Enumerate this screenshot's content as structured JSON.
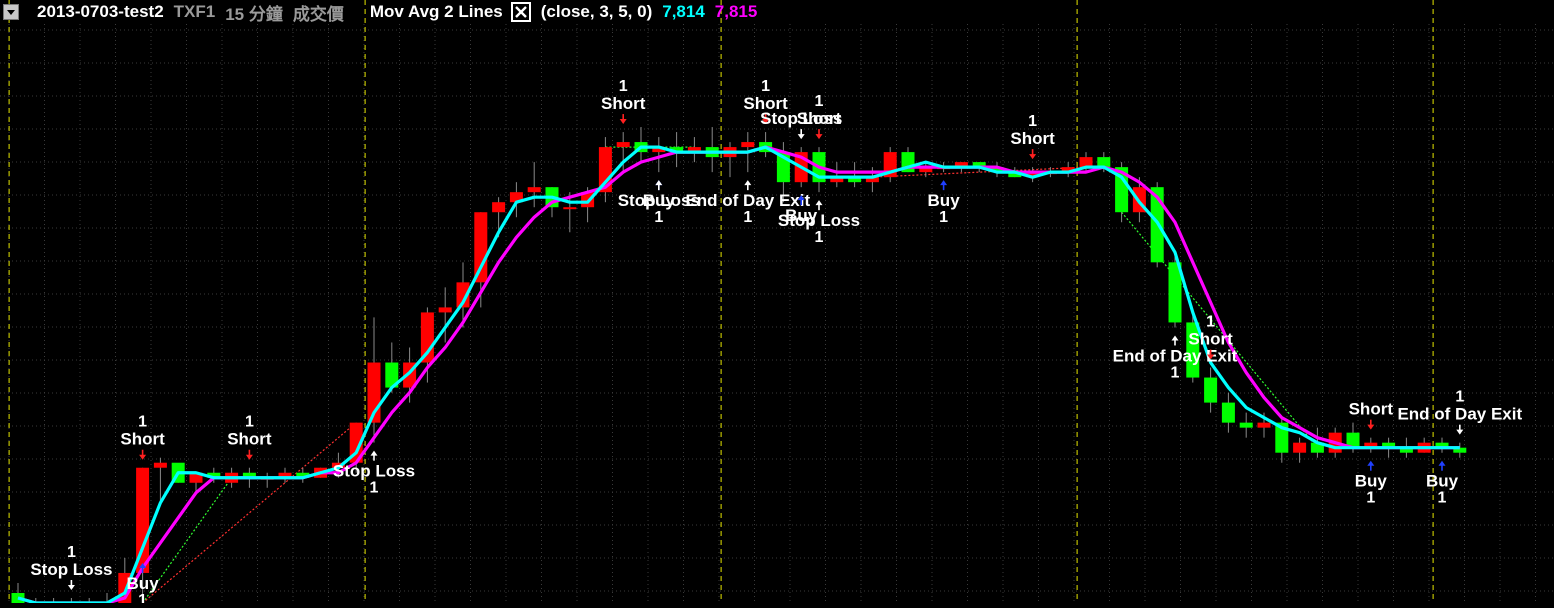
{
  "header": {
    "menu_icon": "dropdown-arrow-icon",
    "strategy": "2013-0703-test2",
    "symbol": "TXF1",
    "interval": "15 分鐘",
    "field": "成交價",
    "indicator": "Mov Avg 2 Lines",
    "close_icon": "close-x-icon",
    "params": "(close,  3,  5,  0)",
    "ma1_value": "7,814",
    "ma2_value": "7,815"
  },
  "colors": {
    "background": "#000000",
    "grid": "#3a3a3a",
    "session_divider": "#e6e600",
    "up_candle": "#ff0000",
    "down_candle": "#00ff00",
    "ma_fast": "#00ffff",
    "ma_slow": "#ff00ff",
    "label": "#ffffff",
    "short_arrow": "#ff2020",
    "buy_arrow": "#2040ff",
    "exit_arrow": "#ffffff",
    "trade_loss": "#ff3030",
    "trade_win": "#30ff30"
  },
  "chart_data": {
    "type": "candlestick",
    "title": "2013-0703-test2 TXF1 15 分鐘 成交價",
    "ylim": [
      0,
      100
    ],
    "grid": true,
    "session_dividers": [
      0,
      20,
      40,
      60,
      80
    ],
    "candles": [
      {
        "o": 2,
        "h": 4,
        "l": 0,
        "c": 0
      },
      {
        "o": 0,
        "h": 1,
        "l": 0,
        "c": 0
      },
      {
        "o": 0,
        "h": 1,
        "l": 0,
        "c": 0
      },
      {
        "o": 0,
        "h": 1,
        "l": 0,
        "c": 0
      },
      {
        "o": 0,
        "h": 1,
        "l": 0,
        "c": 0
      },
      {
        "o": 0,
        "h": 2,
        "l": 0,
        "c": 0
      },
      {
        "o": 0,
        "h": 9,
        "l": 0,
        "c": 6
      },
      {
        "o": 6,
        "h": 27,
        "l": 0,
        "c": 27
      },
      {
        "o": 27,
        "h": 29,
        "l": 20,
        "c": 28
      },
      {
        "o": 28,
        "h": 27,
        "l": 24,
        "c": 24
      },
      {
        "o": 24,
        "h": 26,
        "l": 22,
        "c": 26
      },
      {
        "o": 26,
        "h": 27,
        "l": 24,
        "c": 25
      },
      {
        "o": 24,
        "h": 27,
        "l": 23,
        "c": 26
      },
      {
        "o": 26,
        "h": 27,
        "l": 23,
        "c": 25
      },
      {
        "o": 25,
        "h": 26,
        "l": 23,
        "c": 25
      },
      {
        "o": 25,
        "h": 27,
        "l": 24,
        "c": 26
      },
      {
        "o": 26,
        "h": 27,
        "l": 24,
        "c": 25
      },
      {
        "o": 25,
        "h": 27,
        "l": 25,
        "c": 27
      },
      {
        "o": 27,
        "h": 30,
        "l": 25,
        "c": 28
      },
      {
        "o": 28,
        "h": 36,
        "l": 26,
        "c": 36
      },
      {
        "o": 36,
        "h": 57,
        "l": 32,
        "c": 48
      },
      {
        "o": 48,
        "h": 52,
        "l": 42,
        "c": 43
      },
      {
        "o": 43,
        "h": 51,
        "l": 40,
        "c": 48
      },
      {
        "o": 48,
        "h": 59,
        "l": 44,
        "c": 58
      },
      {
        "o": 58,
        "h": 63,
        "l": 52,
        "c": 59
      },
      {
        "o": 59,
        "h": 68,
        "l": 55,
        "c": 64
      },
      {
        "o": 64,
        "h": 78,
        "l": 59,
        "c": 78
      },
      {
        "o": 78,
        "h": 81,
        "l": 73,
        "c": 80
      },
      {
        "o": 80,
        "h": 84,
        "l": 77,
        "c": 82
      },
      {
        "o": 82,
        "h": 88,
        "l": 79,
        "c": 83
      },
      {
        "o": 83,
        "h": 83,
        "l": 77,
        "c": 79
      },
      {
        "o": 79,
        "h": 82,
        "l": 74,
        "c": 79
      },
      {
        "o": 79,
        "h": 83,
        "l": 76,
        "c": 82
      },
      {
        "o": 82,
        "h": 93,
        "l": 80,
        "c": 91
      },
      {
        "o": 91,
        "h": 94,
        "l": 86,
        "c": 92
      },
      {
        "o": 92,
        "h": 95,
        "l": 88,
        "c": 90
      },
      {
        "o": 90,
        "h": 93,
        "l": 86,
        "c": 91
      },
      {
        "o": 91,
        "h": 94,
        "l": 87,
        "c": 90
      },
      {
        "o": 90,
        "h": 93,
        "l": 88,
        "c": 91
      },
      {
        "o": 91,
        "h": 95,
        "l": 86,
        "c": 89
      },
      {
        "o": 89,
        "h": 92,
        "l": 85,
        "c": 91
      },
      {
        "o": 91,
        "h": 94,
        "l": 86,
        "c": 92
      },
      {
        "o": 92,
        "h": 94,
        "l": 89,
        "c": 90
      },
      {
        "o": 90,
        "h": 92,
        "l": 80,
        "c": 84
      },
      {
        "o": 84,
        "h": 91,
        "l": 83,
        "c": 90
      },
      {
        "o": 90,
        "h": 91,
        "l": 82,
        "c": 84
      },
      {
        "o": 84,
        "h": 88,
        "l": 83,
        "c": 85
      },
      {
        "o": 85,
        "h": 88,
        "l": 83,
        "c": 84
      },
      {
        "o": 84,
        "h": 87,
        "l": 82,
        "c": 85
      },
      {
        "o": 85,
        "h": 91,
        "l": 84,
        "c": 90
      },
      {
        "o": 90,
        "h": 91,
        "l": 86,
        "c": 86
      },
      {
        "o": 86,
        "h": 88,
        "l": 85,
        "c": 87
      },
      {
        "o": 87,
        "h": 88,
        "l": 86,
        "c": 87
      },
      {
        "o": 87,
        "h": 88,
        "l": 86,
        "c": 88
      },
      {
        "o": 88,
        "h": 88,
        "l": 86,
        "c": 87
      },
      {
        "o": 87,
        "h": 88,
        "l": 85,
        "c": 86
      },
      {
        "o": 86,
        "h": 87,
        "l": 85,
        "c": 85
      },
      {
        "o": 85,
        "h": 87,
        "l": 84,
        "c": 86
      },
      {
        "o": 86,
        "h": 87,
        "l": 85,
        "c": 86
      },
      {
        "o": 86,
        "h": 88,
        "l": 85,
        "c": 87
      },
      {
        "o": 87,
        "h": 90,
        "l": 86,
        "c": 89
      },
      {
        "o": 89,
        "h": 90,
        "l": 86,
        "c": 87
      },
      {
        "o": 87,
        "h": 88,
        "l": 76,
        "c": 78
      },
      {
        "o": 78,
        "h": 85,
        "l": 76,
        "c": 83
      },
      {
        "o": 83,
        "h": 84,
        "l": 67,
        "c": 68
      },
      {
        "o": 68,
        "h": 70,
        "l": 55,
        "c": 56
      },
      {
        "o": 56,
        "h": 58,
        "l": 44,
        "c": 45
      },
      {
        "o": 45,
        "h": 47,
        "l": 38,
        "c": 40
      },
      {
        "o": 40,
        "h": 42,
        "l": 34,
        "c": 36
      },
      {
        "o": 36,
        "h": 38,
        "l": 33,
        "c": 35
      },
      {
        "o": 35,
        "h": 38,
        "l": 33,
        "c": 36
      },
      {
        "o": 36,
        "h": 37,
        "l": 28,
        "c": 30
      },
      {
        "o": 30,
        "h": 33,
        "l": 28,
        "c": 32
      },
      {
        "o": 32,
        "h": 35,
        "l": 29,
        "c": 30
      },
      {
        "o": 30,
        "h": 35,
        "l": 29,
        "c": 34
      },
      {
        "o": 34,
        "h": 36,
        "l": 30,
        "c": 31
      },
      {
        "o": 31,
        "h": 33,
        "l": 30,
        "c": 32
      },
      {
        "o": 32,
        "h": 33,
        "l": 29,
        "c": 31
      },
      {
        "o": 31,
        "h": 33,
        "l": 29,
        "c": 30
      },
      {
        "o": 30,
        "h": 33,
        "l": 30,
        "c": 32
      },
      {
        "o": 32,
        "h": 33,
        "l": 30,
        "c": 31
      },
      {
        "o": 31,
        "h": 32,
        "l": 29,
        "c": 30
      }
    ],
    "series": [
      {
        "name": "Mov Avg 2 Lines (close, 3)",
        "values": [
          1,
          0,
          0,
          0,
          0,
          0,
          2,
          11,
          20,
          26,
          26,
          25,
          25,
          25,
          25,
          25,
          25,
          26,
          27,
          30,
          38,
          43,
          46,
          50,
          55,
          60,
          67,
          74,
          80,
          81,
          81,
          80,
          80,
          84,
          88,
          91,
          91,
          90,
          90,
          90,
          90,
          90,
          91,
          89,
          87,
          85,
          85,
          85,
          85,
          86,
          87,
          88,
          87,
          87,
          87,
          86,
          86,
          85,
          86,
          86,
          87,
          87,
          85,
          80,
          76,
          70,
          58,
          48,
          43,
          39,
          37,
          35,
          34,
          32,
          31,
          31,
          31,
          31,
          31,
          31,
          31,
          31
        ]
      },
      {
        "name": "Mov Avg 2 Lines (close, 5)",
        "values": [
          1,
          0,
          0,
          0,
          0,
          0,
          1,
          7,
          12,
          17,
          22,
          25,
          25,
          25,
          25,
          25,
          25,
          26,
          26,
          28,
          33,
          38,
          42,
          47,
          51,
          56,
          62,
          68,
          73,
          77,
          80,
          81,
          82,
          83,
          86,
          88,
          89,
          90,
          90,
          90,
          90,
          90,
          91,
          90,
          89,
          87,
          86,
          86,
          86,
          86,
          87,
          87,
          87,
          87,
          87,
          87,
          86,
          86,
          86,
          86,
          86,
          87,
          86,
          84,
          81,
          76,
          68,
          60,
          52,
          46,
          41,
          37,
          35,
          33,
          32,
          31,
          31,
          31,
          31,
          31,
          31,
          31
        ]
      }
    ],
    "trades": [
      {
        "from": 7,
        "from_value": 0,
        "to": 19,
        "to_value": 36,
        "result": "loss"
      },
      {
        "from": 7,
        "from_value": 0,
        "to": 12,
        "to_value": 25,
        "result": "win"
      },
      {
        "from": 33,
        "from_value": 91,
        "to": 38,
        "to_value": 91,
        "result": "win"
      },
      {
        "from": 48,
        "from_value": 85,
        "to": 60,
        "to_value": 87,
        "result": "loss"
      },
      {
        "from": 62,
        "from_value": 78,
        "to": 73,
        "to_value": 31,
        "result": "win"
      }
    ],
    "signals": [
      {
        "bar": 3,
        "side": "above",
        "type": "exit",
        "label": "Stop Loss",
        "qty": "1"
      },
      {
        "bar": 7,
        "side": "above",
        "type": "short",
        "label": "Short",
        "qty": "1"
      },
      {
        "bar": 7,
        "side": "below",
        "type": "buy",
        "label": "Buy",
        "qty": "1"
      },
      {
        "bar": 13,
        "side": "above",
        "type": "short",
        "label": "Short",
        "qty": "1"
      },
      {
        "bar": 20,
        "side": "below",
        "type": "exit",
        "label": "Stop Loss",
        "qty": "1"
      },
      {
        "bar": 34,
        "side": "above",
        "type": "short",
        "label": "Short",
        "qty": "1"
      },
      {
        "bar": 36,
        "side": "below",
        "type": "buy",
        "label": "Buy",
        "qty": ""
      },
      {
        "bar": 36,
        "side": "below",
        "type": "exit",
        "label": "Stop Loss",
        "qty": "1"
      },
      {
        "bar": 41,
        "side": "below",
        "type": "exit",
        "label": "End of Day Exit",
        "qty": "1"
      },
      {
        "bar": 42,
        "side": "above",
        "type": "short",
        "label": "Short",
        "qty": "1"
      },
      {
        "bar": 44,
        "side": "above",
        "type": "exit",
        "label": "Stop Loss",
        "qty": ""
      },
      {
        "bar": 44,
        "side": "below",
        "type": "buy",
        "label": "Buy",
        "qty": ""
      },
      {
        "bar": 45,
        "side": "above",
        "type": "short",
        "label": "Short",
        "qty": "1"
      },
      {
        "bar": 45,
        "side": "below",
        "type": "exit",
        "label": "Stop Loss",
        "qty": "1"
      },
      {
        "bar": 52,
        "side": "below",
        "type": "buy",
        "label": "Buy",
        "qty": "1"
      },
      {
        "bar": 57,
        "side": "above",
        "type": "short",
        "label": "Short",
        "qty": "1"
      },
      {
        "bar": 65,
        "side": "below",
        "type": "exit",
        "label": "End of Day Exit",
        "qty": "1"
      },
      {
        "bar": 67,
        "side": "above",
        "type": "short",
        "label": "Short",
        "qty": "1"
      },
      {
        "bar": 76,
        "side": "above",
        "type": "short",
        "label": "Short",
        "qty": ""
      },
      {
        "bar": 76,
        "side": "below",
        "type": "buy",
        "label": "Buy",
        "qty": "1"
      },
      {
        "bar": 81,
        "side": "above",
        "type": "exit",
        "label": "End of Day Exit",
        "qty": "1"
      },
      {
        "bar": 80,
        "side": "below",
        "type": "buy",
        "label": "Buy",
        "qty": "1"
      }
    ]
  }
}
